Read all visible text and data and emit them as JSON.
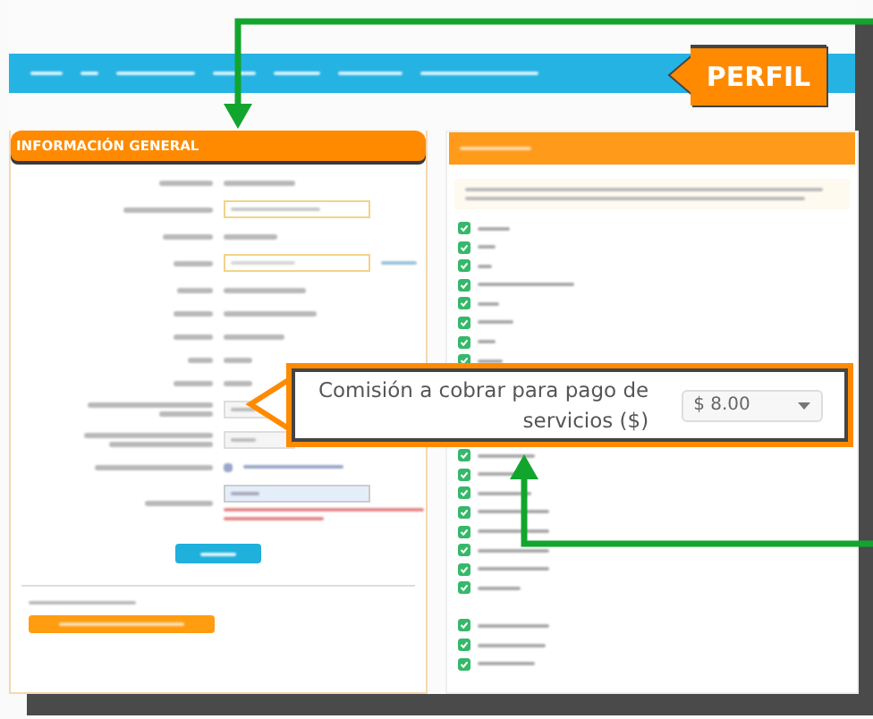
{
  "nav": {
    "callout": "PERFIL"
  },
  "left_panel": {
    "title": "INFORMACIÓN GENERAL"
  },
  "zoom_callout": {
    "label": "Comisión a cobrar para pago de servicios ($)",
    "value": "$ 8.00"
  }
}
